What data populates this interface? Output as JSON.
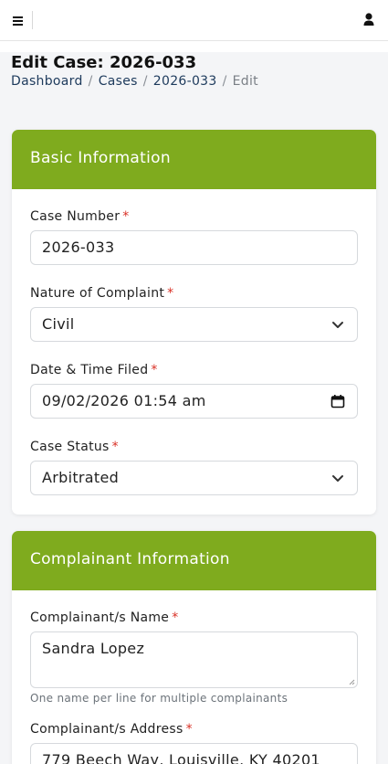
{
  "header": {
    "menu_icon": "hamburger-icon",
    "user_icon": "user-icon"
  },
  "page": {
    "title": "Edit Case: 2026-033",
    "breadcrumb": [
      "Dashboard",
      "Cases",
      "2026-033",
      "Edit"
    ]
  },
  "basic_info": {
    "title": "Basic Information",
    "case_number": {
      "label": "Case Number",
      "value": "2026-033"
    },
    "nature": {
      "label": "Nature of Complaint",
      "value": "Civil"
    },
    "date_filed": {
      "label": "Date & Time Filed",
      "value": "09/02/2026 01:54 am"
    },
    "status": {
      "label": "Case Status",
      "value": "Arbitrated"
    },
    "required_mark": "*"
  },
  "complainant_info": {
    "title": "Complainant Information",
    "name": {
      "label": "Complainant/s Name",
      "value": "Sandra Lopez",
      "help": "One name per line for multiple complainants"
    },
    "address": {
      "label": "Complainant/s Address",
      "value": "779 Beech Way, Louisville, KY 40201"
    },
    "required_mark": "*"
  },
  "colors": {
    "accent": "#7fab1e",
    "required": "#d93025",
    "link": "#1d3a5c"
  }
}
